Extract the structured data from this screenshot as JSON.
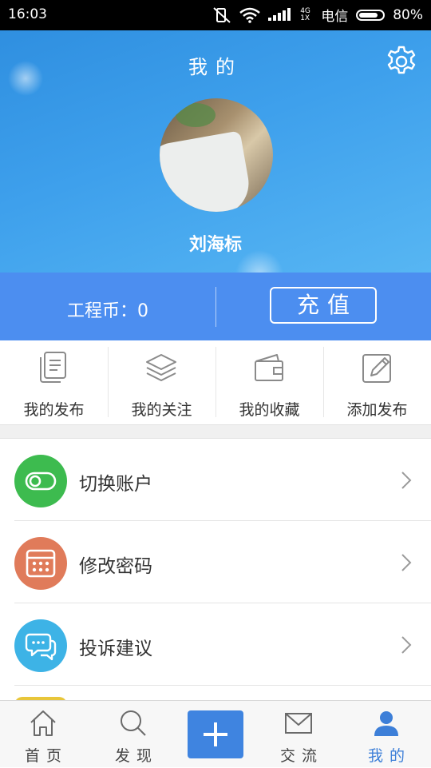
{
  "status_bar": {
    "time": "16:03",
    "network": "4G 1X",
    "carrier": "电信",
    "battery": "80%",
    "battery_level": 0.8
  },
  "header": {
    "title": "我的",
    "username": "刘海标"
  },
  "coins": {
    "label": "工程币：0",
    "recharge_label": "充值"
  },
  "quick_actions": [
    {
      "label": "我的发布",
      "icon": "document-icon"
    },
    {
      "label": "我的关注",
      "icon": "layers-icon"
    },
    {
      "label": "我的收藏",
      "icon": "wallet-icon"
    },
    {
      "label": "添加发布",
      "icon": "edit-icon"
    }
  ],
  "menu": [
    {
      "label": "切换账户",
      "icon": "toggle-icon",
      "color": "#3dbb4f"
    },
    {
      "label": "修改密码",
      "icon": "keypad-icon",
      "color": "#e07b5a"
    },
    {
      "label": "投诉建议",
      "icon": "chat-icon",
      "color": "#3db3e6"
    }
  ],
  "bottom_nav": [
    {
      "label": "首页",
      "icon": "home-icon"
    },
    {
      "label": "发现",
      "icon": "search-icon"
    },
    {
      "label": "",
      "icon": "plus-icon"
    },
    {
      "label": "交流",
      "icon": "mail-icon"
    },
    {
      "label": "我的",
      "icon": "user-icon",
      "active": true
    }
  ],
  "colors": {
    "accent": "#4c8ef0",
    "header_blue": "#3ea0ec",
    "active_nav": "#3d7fd8"
  }
}
